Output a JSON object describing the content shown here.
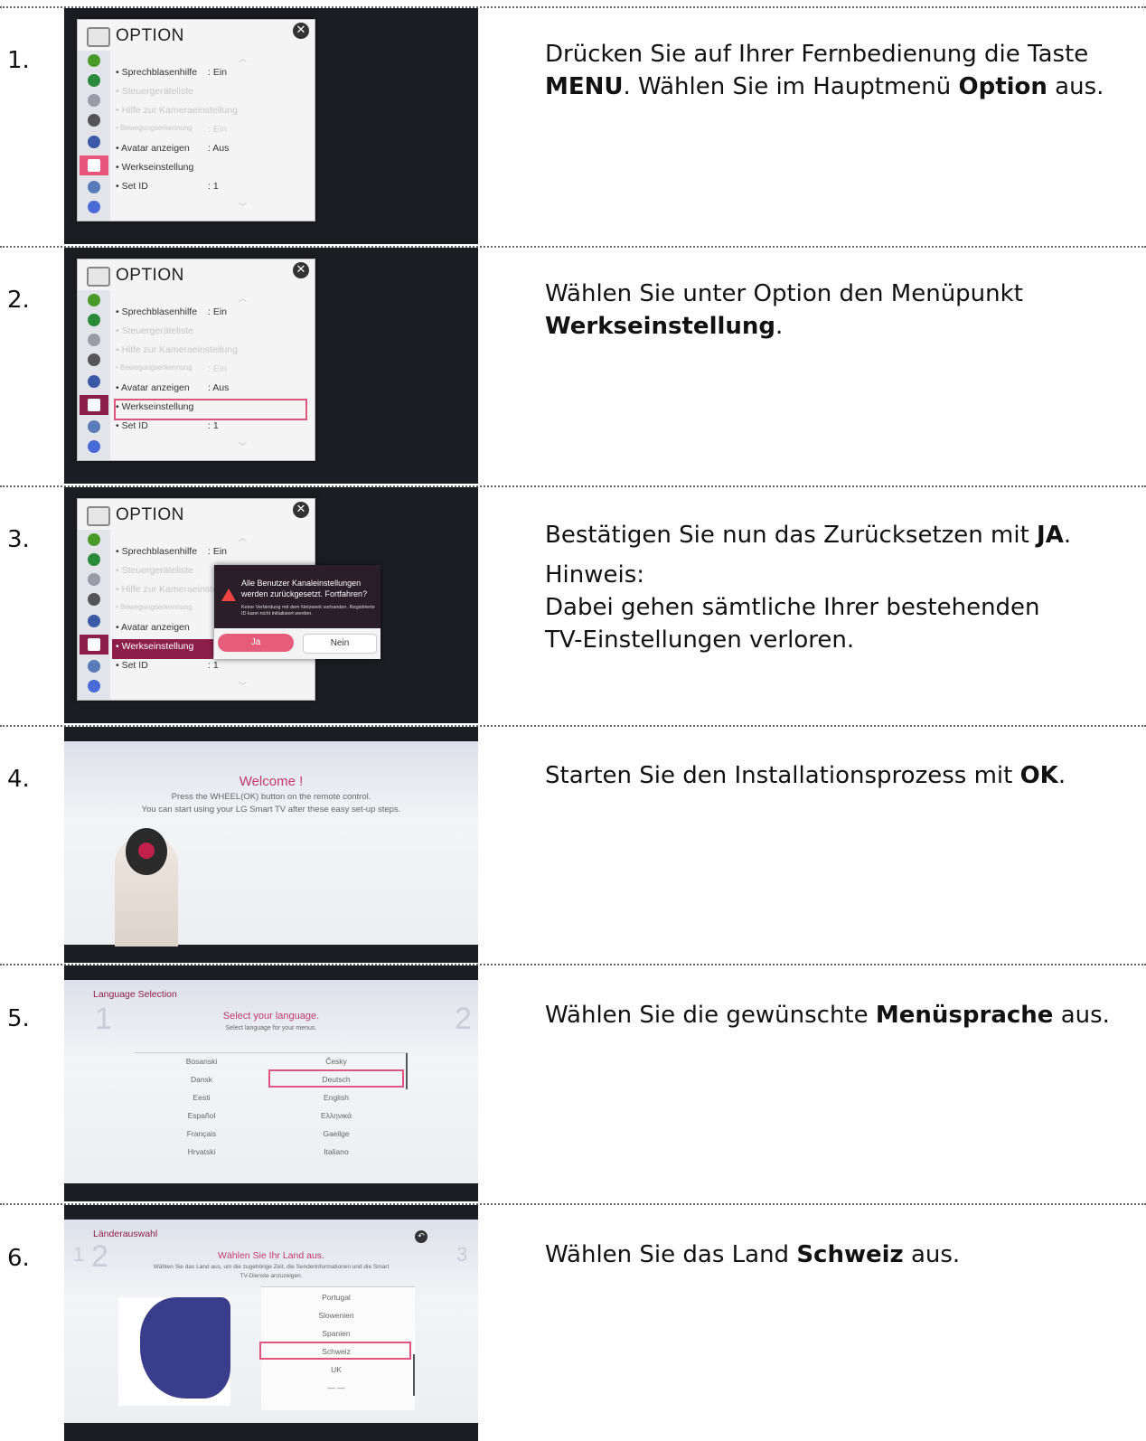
{
  "steps": [
    {
      "number": "1.",
      "desc": [
        "Drücken Sie auf Ihrer Fernbedienung die Taste ",
        "MENU",
        ". Wählen Sie im Hauptmenü ",
        "Option",
        " aus."
      ]
    },
    {
      "number": "2.",
      "desc": [
        "Wählen Sie unter Option den Menüpunkt ",
        "Werkseinstellung",
        "."
      ]
    },
    {
      "number": "3.",
      "desc": [
        "Bestätigen Sie nun das Zurücksetzen mit ",
        "JA",
        "."
      ],
      "note_label": "Hinweis:",
      "note_text": "Dabei gehen sämtliche Ihrer bestehenden TV-Einstellungen verloren."
    },
    {
      "number": "4.",
      "desc": [
        "Starten Sie den Installationsprozess mit ",
        "OK",
        "."
      ]
    },
    {
      "number": "5.",
      "desc": [
        "Wählen Sie die gewünschte ",
        "Menüsprache",
        " aus."
      ]
    },
    {
      "number": "6.",
      "desc": [
        "Wählen Sie das Land ",
        "Schweiz",
        " aus."
      ]
    }
  ],
  "option_menu": {
    "title": "OPTION",
    "close_glyph": "✕",
    "items": [
      {
        "label": "• Sprechblasenhilfe",
        "value": ": Ein",
        "dim": false
      },
      {
        "label": "• Steuergeräteliste",
        "value": "",
        "dim": true
      },
      {
        "label": "• Hilfe zur Kameraeinstellung",
        "value": "",
        "dim": true
      },
      {
        "label": "• Bewegungserkennung",
        "value": ": Ein",
        "dim": true
      },
      {
        "label": "• Avatar anzeigen",
        "value": ": Aus",
        "dim": false
      },
      {
        "label": "• Werkseinstellung",
        "value": "",
        "dim": false
      },
      {
        "label": "• Set ID",
        "value": ": 1",
        "dim": false
      }
    ],
    "side_icon_colors": [
      "#4a9a2a",
      "#2a8a3a",
      "#9a9aa8",
      "#555",
      "#3a5aa8",
      "#cc2244",
      "#5a7ab8",
      "#4a6ad8"
    ]
  },
  "reset_dialog": {
    "message": "Alle Benutzer Kanaleinstellungen werden zurückgesetzt. Fortfahren?",
    "detail": "Keine Verbindung mit dem Netzwerk vorhanden. Registrierte ID kann nicht initialisiert werden.",
    "yes_label": "Ja",
    "no_label": "Nein"
  },
  "welcome": {
    "title": "Welcome !",
    "line1": "Press the WHEEL(OK) button on the remote control.",
    "line2": "You can start using your LG Smart TV after these easy set-up steps."
  },
  "language": {
    "header": "Language Selection",
    "step_current": "1",
    "step_next": "2",
    "title": "Select your language.",
    "subtitle": "Select language for your menus.",
    "left": [
      "Bosanski",
      "Dansk",
      "Eesti",
      "Español",
      "Français",
      "Hrvatski"
    ],
    "right": [
      "Česky",
      "Deutsch",
      "English",
      "Ελληνικά",
      "Gaeilge",
      "Italiano"
    ],
    "selected": "Deutsch"
  },
  "country": {
    "header": "Länderauswahl",
    "step_prev": "1",
    "step_current": "2",
    "step_next": "3",
    "title": "Wählen Sie Ihr Land aus.",
    "subtitle1": "Wählen Sie das Land aus, um die zugehörige Zeit, die Senderinformationen und die Smart",
    "subtitle2": "TV-Dienste anzuzeigen.",
    "list": [
      "Portugal",
      "Slowenien",
      "Spanien",
      "Schweiz",
      "UK",
      "— —"
    ],
    "selected": "Schweiz",
    "back_glyph": "↶"
  }
}
